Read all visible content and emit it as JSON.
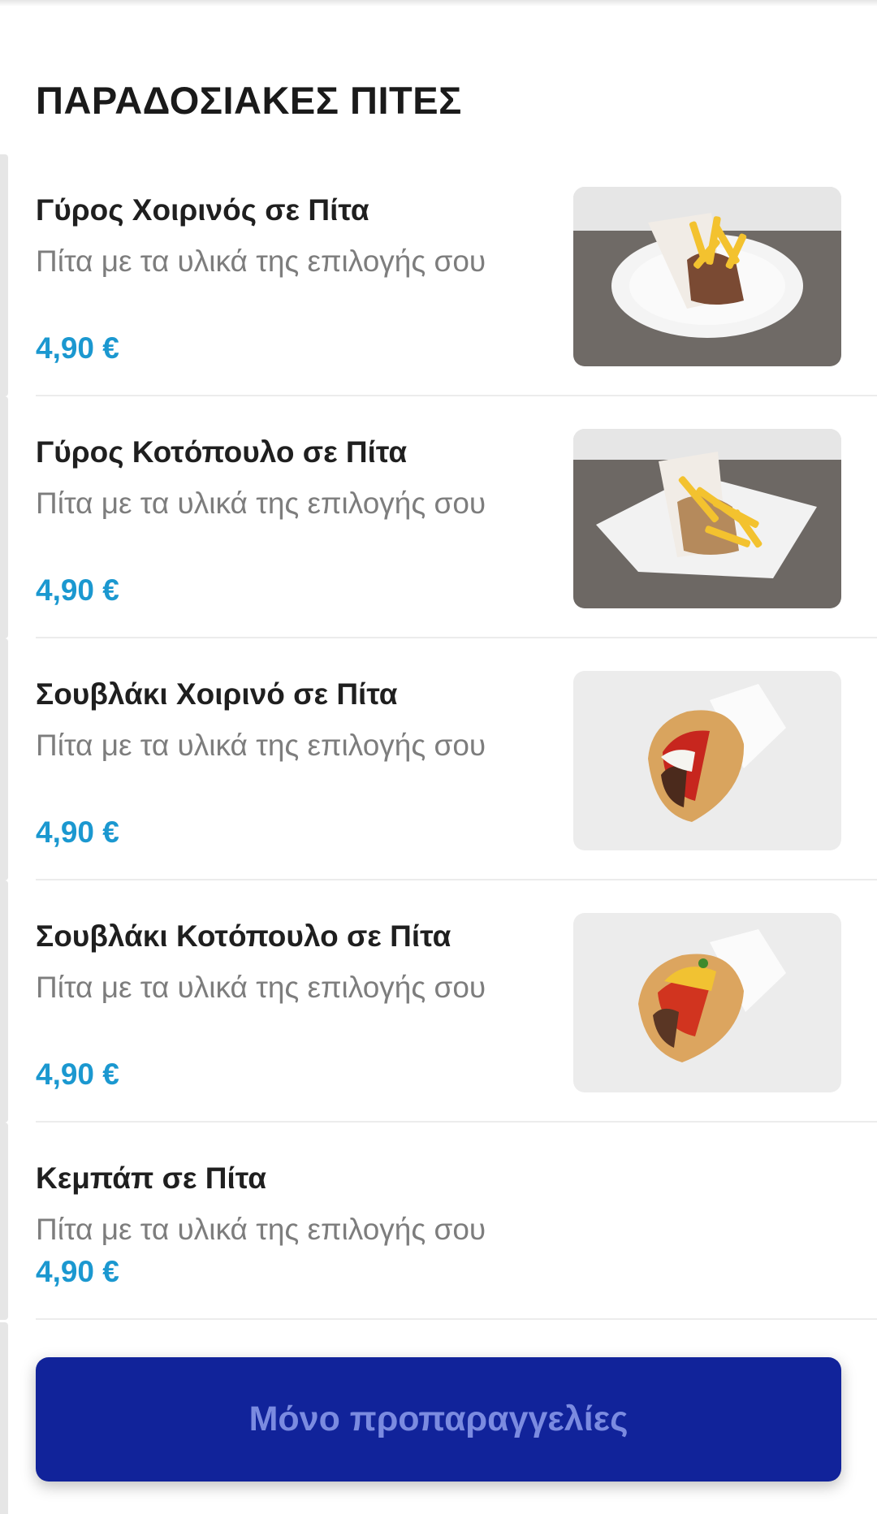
{
  "section": {
    "title": "ΠΑΡΑΔΟΣΙΑΚΕΣ ΠΙΤΕΣ"
  },
  "items": [
    {
      "name": "Γύρος Χοιρινός σε Πίτα",
      "description": "Πίτα με τα υλικά της επιλογής σου",
      "price": "4,90 €",
      "image": "pork-gyros-pita-photo"
    },
    {
      "name": "Γύρος Κοτόπουλο σε Πίτα",
      "description": "Πίτα με τα υλικά της επιλογής σου",
      "price": "4,90 €",
      "image": "chicken-gyros-pita-photo"
    },
    {
      "name": "Σουβλάκι Χοιρινό σε Πίτα",
      "description": "Πίτα με τα υλικά της επιλογής σου",
      "price": "4,90 €",
      "image": "pork-souvlaki-pita-photo"
    },
    {
      "name": "Σουβλάκι Κοτόπουλο σε Πίτα",
      "description": "Πίτα με τα υλικά της επιλογής σου",
      "price": "4,90 €",
      "image": "chicken-souvlaki-pita-photo"
    },
    {
      "name": "Κεμπάπ σε Πίτα",
      "description": "Πίτα με τα υλικά της επιλογής σου",
      "price": "4,90 €"
    }
  ],
  "footer": {
    "button_label": "Μόνο προπαραγγελίες"
  },
  "colors": {
    "price": "#1b98d0",
    "button_bg": "#11239a",
    "button_text": "#7b8be0"
  }
}
